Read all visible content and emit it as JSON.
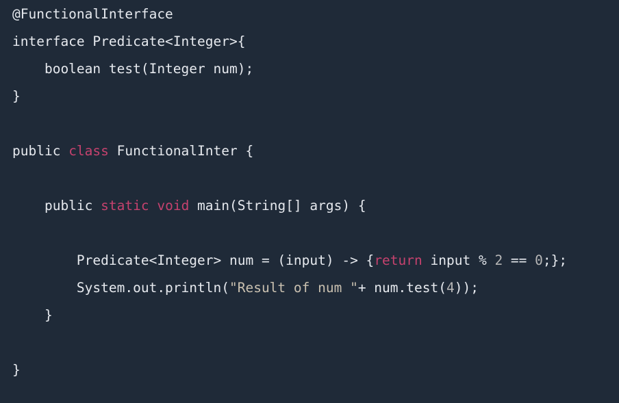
{
  "code": {
    "language": "Java",
    "lines": [
      [
        {
          "t": "@FunctionalInterface",
          "c": "plain"
        }
      ],
      [
        {
          "t": "interface Predicate<Integer>{",
          "c": "plain"
        }
      ],
      [
        {
          "t": "    boolean test(Integer num);",
          "c": "plain"
        }
      ],
      [
        {
          "t": "}",
          "c": "plain"
        }
      ],
      [],
      [
        {
          "t": "public ",
          "c": "plain"
        },
        {
          "t": "class",
          "c": "kw"
        },
        {
          "t": " FunctionalInter {",
          "c": "plain"
        }
      ],
      [],
      [
        {
          "t": "    public ",
          "c": "plain"
        },
        {
          "t": "static",
          "c": "kw"
        },
        {
          "t": " ",
          "c": "plain"
        },
        {
          "t": "void",
          "c": "kw"
        },
        {
          "t": " main(String[] args) {",
          "c": "plain"
        }
      ],
      [],
      [
        {
          "t": "        Predicate<Integer> num = (input) -> {",
          "c": "plain"
        },
        {
          "t": "return",
          "c": "kw"
        },
        {
          "t": " input % ",
          "c": "plain"
        },
        {
          "t": "2",
          "c": "num"
        },
        {
          "t": " == ",
          "c": "plain"
        },
        {
          "t": "0",
          "c": "num"
        },
        {
          "t": ";};",
          "c": "plain"
        }
      ],
      [
        {
          "t": "        System.out.println(",
          "c": "plain"
        },
        {
          "t": "\"Result of num \"",
          "c": "str"
        },
        {
          "t": "+ num.test(",
          "c": "plain"
        },
        {
          "t": "4",
          "c": "num"
        },
        {
          "t": "));",
          "c": "plain"
        }
      ],
      [
        {
          "t": "    }",
          "c": "plain"
        }
      ],
      [],
      [
        {
          "t": "}",
          "c": "plain"
        }
      ]
    ]
  },
  "colors": {
    "background": "#1f2a38",
    "text": "#e6e9ee",
    "keyword": "#c6426e",
    "string": "#c9c0b0",
    "number": "#b6b6b6"
  }
}
